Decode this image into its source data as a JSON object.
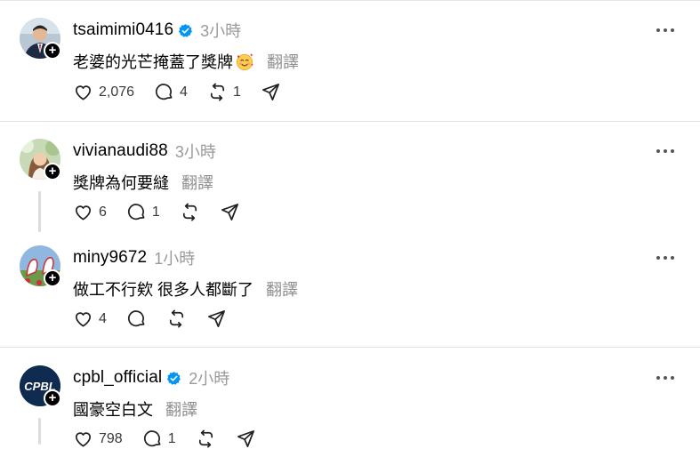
{
  "posts": [
    {
      "username": "tsaimimi0416",
      "verified": true,
      "time": "3小時",
      "text": "老婆的光芒掩蓋了獎牌",
      "translate": "翻譯",
      "likes": "2,076",
      "replies": "4",
      "reposts": "1",
      "shares": ""
    },
    {
      "username": "vivianaudi88",
      "verified": false,
      "time": "3小時",
      "text": "獎牌為何要縫",
      "translate": "翻譯",
      "likes": "6",
      "replies": "1",
      "reposts": "",
      "shares": ""
    },
    {
      "username": "miny9672",
      "verified": false,
      "time": "1小時",
      "text": "做工不行欸 很多人都斷了",
      "translate": "翻譯",
      "likes": "4",
      "replies": "",
      "reposts": "",
      "shares": ""
    },
    {
      "username": "cpbl_official",
      "verified": true,
      "time": "2小時",
      "text": "國豪空白文",
      "translate": "翻譯",
      "likes": "798",
      "replies": "1",
      "reposts": "",
      "shares": ""
    }
  ],
  "avatar_logo_text": "CPBL",
  "colors": {
    "verified": "#0095f6",
    "muted": "#8e8e8e",
    "separator": "#e2e2e2"
  },
  "icons": {
    "like": "heart-icon",
    "reply": "comment-icon",
    "repost": "repost-icon",
    "share": "send-icon",
    "more": "more-icon",
    "follow": "plus-icon",
    "verified": "verified-badge-icon",
    "emoji": "smiling-face-with-hearts-emoji"
  }
}
